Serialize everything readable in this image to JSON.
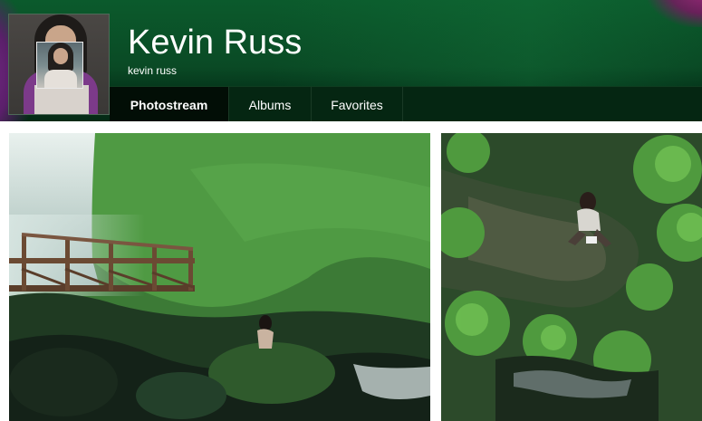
{
  "profile": {
    "display_name": "Kevin Russ",
    "username": "kevin russ",
    "avatar_icon": "avatar-photo"
  },
  "tabs": [
    {
      "label": "Photostream",
      "active": true
    },
    {
      "label": "Albums",
      "active": false
    },
    {
      "label": "Favorites",
      "active": false
    }
  ],
  "colors": {
    "cover_green": "#0a4a25",
    "tab_bar": "#052612",
    "active_tab": "#020e06",
    "deco_purple": "#7a2a8a"
  },
  "photos": [
    {
      "subject": "waterfall-bridge-person-on-rock"
    },
    {
      "subject": "person-sitting-in-forest-ferns"
    }
  ]
}
